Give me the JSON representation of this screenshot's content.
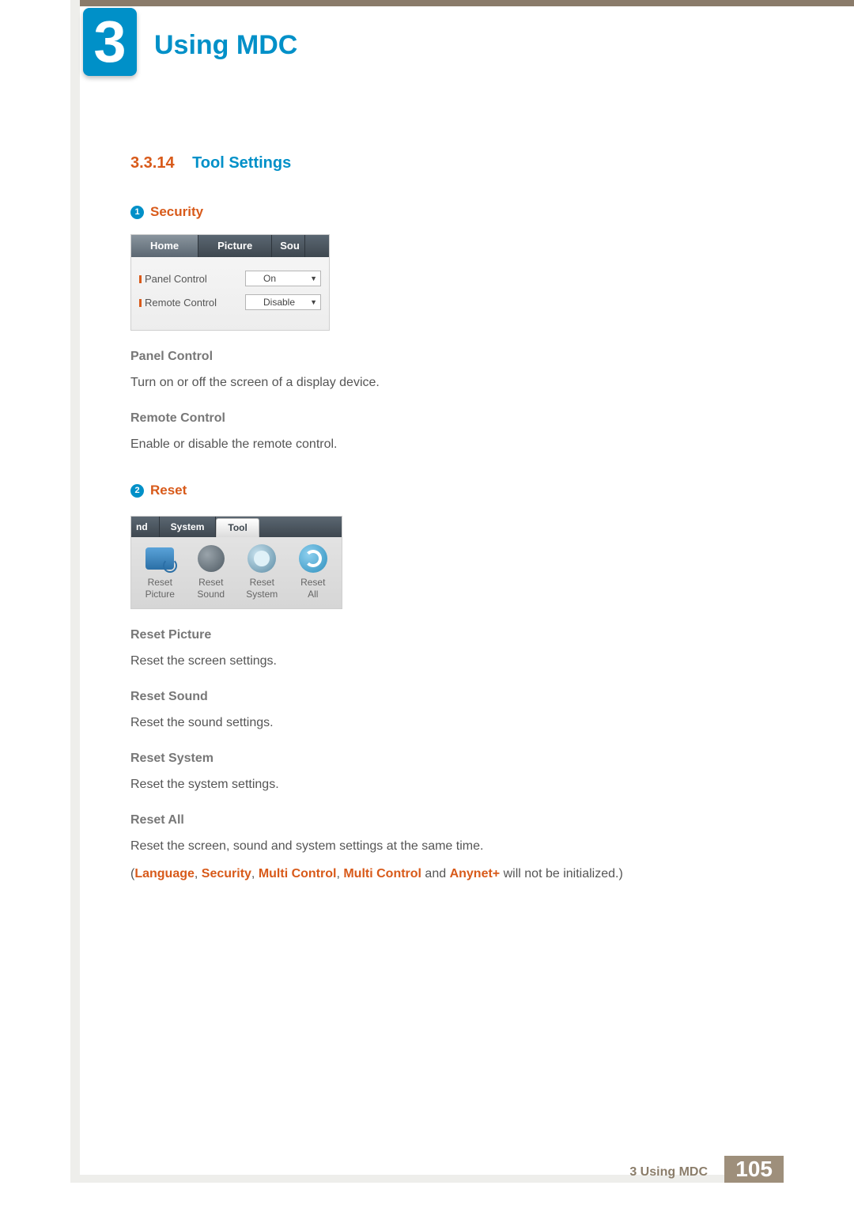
{
  "chapter": {
    "num": "3",
    "title": "Using MDC"
  },
  "section": {
    "num": "3.3.14",
    "title": "Tool Settings"
  },
  "security": {
    "bullet": "1",
    "title": "Security",
    "tabs": {
      "home": "Home",
      "picture": "Picture",
      "sou": "Sou"
    },
    "rows": {
      "panel": {
        "label": "Panel Control",
        "value": "On"
      },
      "remote": {
        "label": "Remote Control",
        "value": "Disable"
      }
    },
    "def_panel_h": "Panel Control",
    "def_panel_p": "Turn on or off the screen of a display device.",
    "def_remote_h": "Remote Control",
    "def_remote_p": "Enable or disable the remote control."
  },
  "reset": {
    "bullet": "2",
    "title": "Reset",
    "tabs": {
      "nd": "nd",
      "system": "System",
      "tool": "Tool"
    },
    "items": {
      "pic": "Reset\nPicture",
      "snd": "Reset\nSound",
      "sys": "Reset\nSystem",
      "all": "Reset\nAll"
    },
    "defs": {
      "pic_h": "Reset Picture",
      "pic_p": "Reset the screen settings.",
      "snd_h": "Reset Sound",
      "snd_p": "Reset the sound settings.",
      "sys_h": "Reset System",
      "sys_p": "Reset the system settings.",
      "all_h": "Reset All",
      "all_p": "Reset the screen, sound and system settings at the same time."
    },
    "note": {
      "open": "(",
      "w1": "Language",
      "c1": ", ",
      "w2": "Security",
      "c2": ", ",
      "w3": "Multi Control",
      "c3": ", ",
      "w4": "Multi Control",
      "and": " and ",
      "w5": "Anynet+",
      "tail": " will not be initialized.)"
    }
  },
  "footer": {
    "label": "3 Using MDC",
    "page": "105"
  }
}
